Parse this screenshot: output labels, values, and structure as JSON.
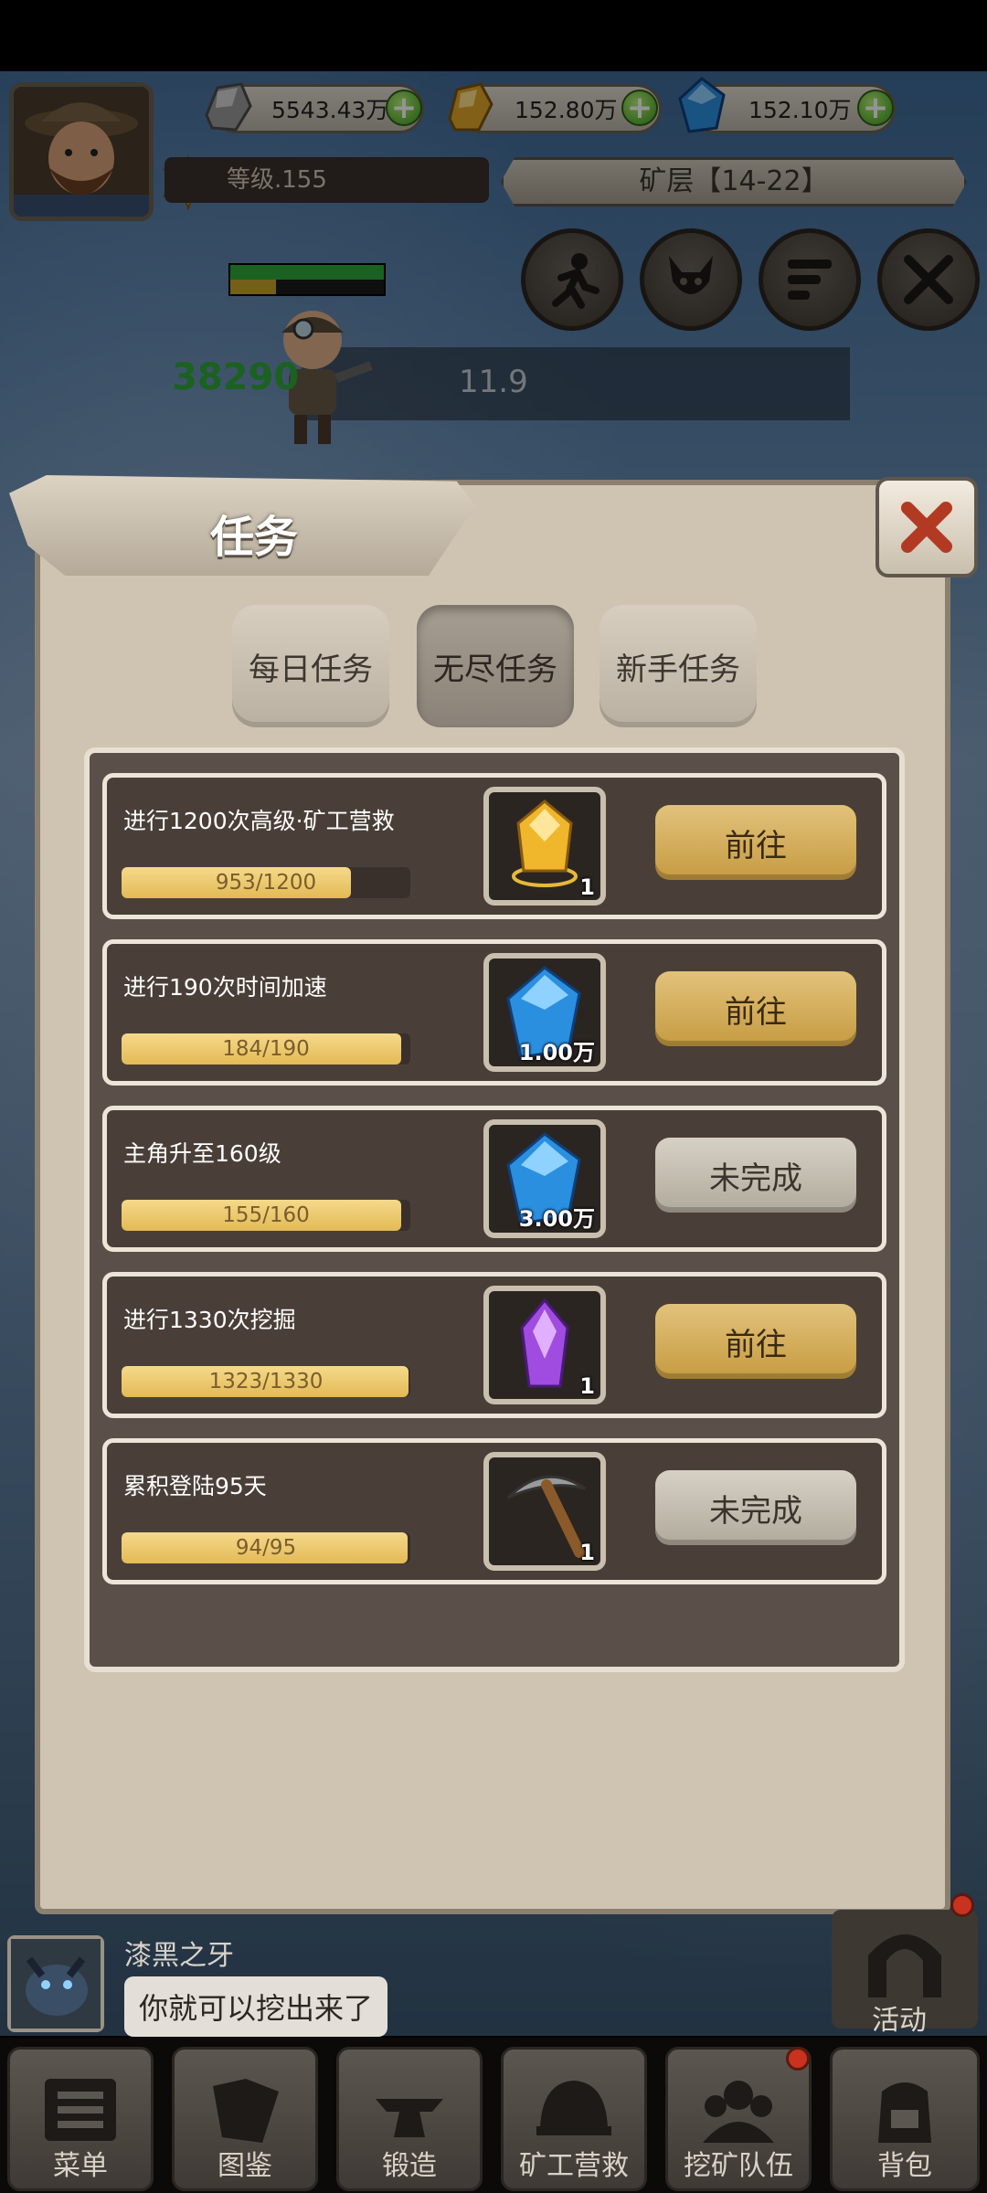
{
  "hud": {
    "resources": [
      {
        "icon": "silver-ore-icon",
        "value": "5543.43万"
      },
      {
        "icon": "gold-ore-icon",
        "value": "152.80万"
      },
      {
        "icon": "blue-diamond-icon",
        "value": "152.10万"
      }
    ],
    "level": "等级.155",
    "mine_layer": "矿层【14-22】",
    "hp_number": "38290",
    "timer": "11.9"
  },
  "dialog": {
    "title": "任务",
    "tabs": [
      {
        "label": "每日任务",
        "active": false
      },
      {
        "label": "无尽任务",
        "active": true
      },
      {
        "label": "新手任务",
        "active": false
      }
    ],
    "tasks": [
      {
        "title": "进行1200次高级·矿工营救",
        "progress": "953/1200",
        "fraction": 0.794,
        "reward_icon": "gold-crystal-icon",
        "reward_count": "1",
        "button": "前往",
        "state": "go"
      },
      {
        "title": "进行190次时间加速",
        "progress": "184/190",
        "fraction": 0.968,
        "reward_icon": "blue-diamond-icon",
        "reward_count": "1.00万",
        "button": "前往",
        "state": "go"
      },
      {
        "title": "主角升至160级",
        "progress": "155/160",
        "fraction": 0.969,
        "reward_icon": "blue-diamond-icon",
        "reward_count": "3.00万",
        "button": "未完成",
        "state": "todo"
      },
      {
        "title": "进行1330次挖掘",
        "progress": "1323/1330",
        "fraction": 0.995,
        "reward_icon": "purple-crystal-icon",
        "reward_count": "1",
        "button": "前往",
        "state": "go"
      },
      {
        "title": "累积登陆95天",
        "progress": "94/95",
        "fraction": 0.989,
        "reward_icon": "pickaxe-icon",
        "reward_count": "1",
        "button": "未完成",
        "state": "todo"
      }
    ]
  },
  "chat": {
    "name": "漆黑之牙",
    "message": "你就可以挖出来了"
  },
  "activity_label": "活动",
  "nav": [
    {
      "label": "菜单",
      "icon": "menu-icon"
    },
    {
      "label": "图鉴",
      "icon": "book-icon"
    },
    {
      "label": "锻造",
      "icon": "anvil-icon"
    },
    {
      "label": "矿工营救",
      "icon": "helmet-icon"
    },
    {
      "label": "挖矿队伍",
      "icon": "team-icon"
    },
    {
      "label": "背包",
      "icon": "backpack-icon"
    }
  ],
  "colors": {
    "accent_gold": "#d9b15a",
    "panel_bg": "#cfc4b2",
    "row_bg": "#4a3f38",
    "green_hp": "#2fa83a"
  }
}
